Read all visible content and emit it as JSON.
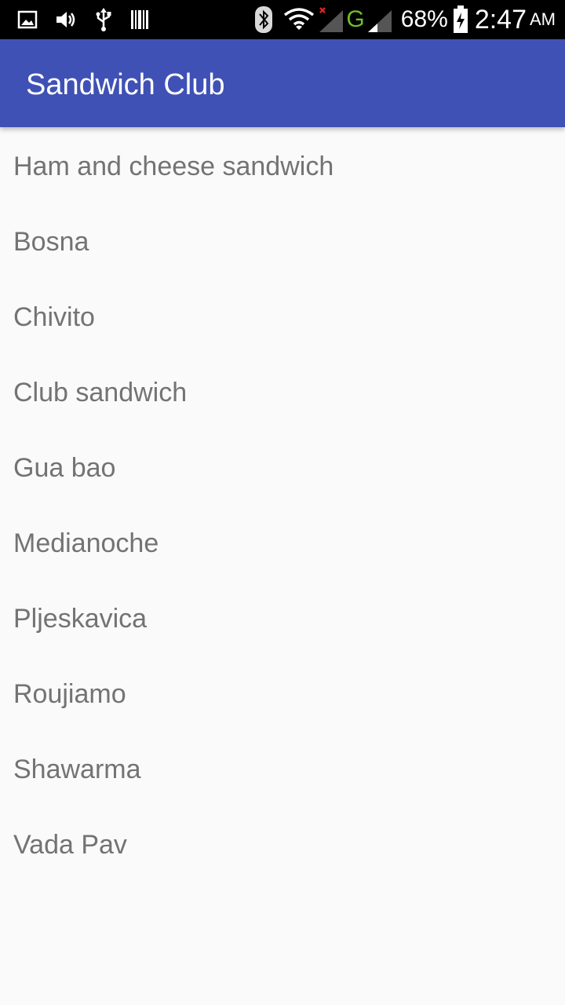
{
  "status_bar": {
    "left_icons": [
      "image-notification-icon",
      "volume-icon",
      "usb-icon",
      "barcode-icon"
    ],
    "right_icons": [
      "bluetooth-icon",
      "wifi-icon",
      "signal-no-service-icon",
      "signal-icon",
      "battery-charging-icon"
    ],
    "network_type": "G",
    "battery_percent": "68%",
    "time": "2:47",
    "ampm": "AM",
    "colors": {
      "network": "#6fbf2a",
      "no_service_x": "#e02020"
    }
  },
  "app_bar": {
    "title": "Sandwich Club",
    "color": "#3f51b5"
  },
  "sandwiches": [
    "Ham and cheese sandwich",
    "Bosna",
    "Chivito",
    "Club sandwich",
    "Gua bao",
    "Medianoche",
    "Pljeskavica",
    "Roujiamo",
    "Shawarma",
    "Vada Pav"
  ]
}
